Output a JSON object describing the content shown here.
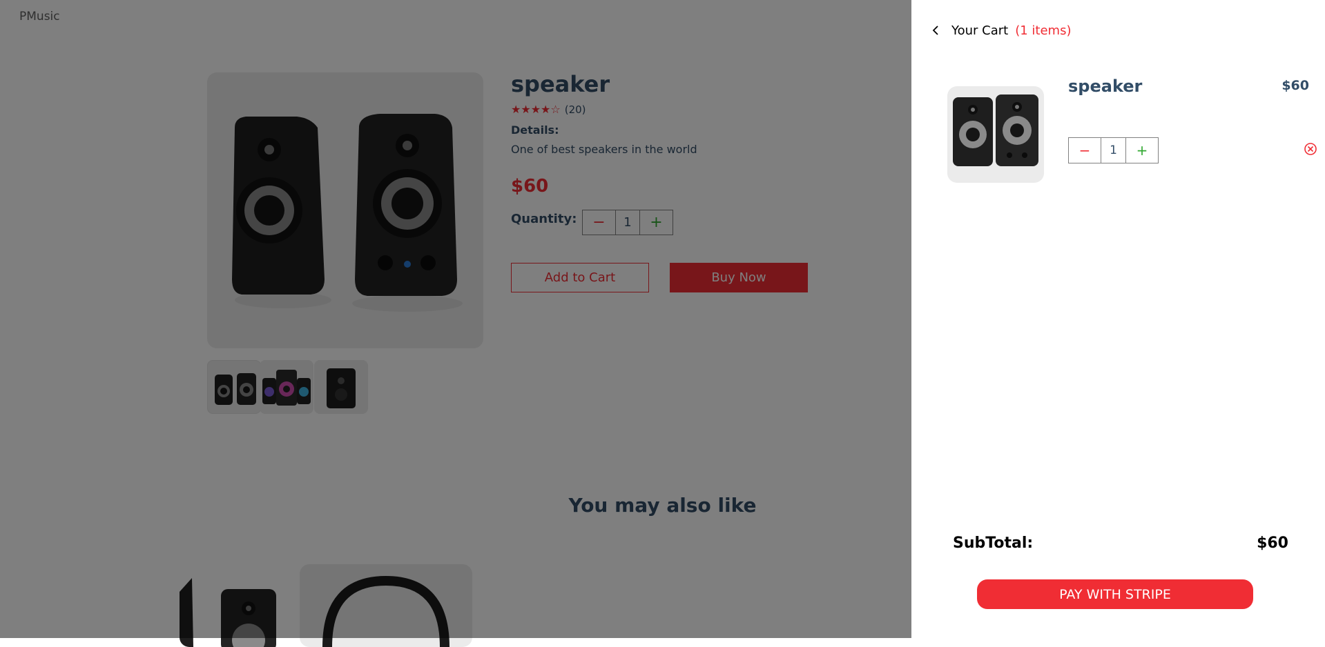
{
  "app": {
    "logo": "PMusic"
  },
  "product": {
    "title": "speaker",
    "rating_stars": "★★★★☆",
    "review_count": "(20)",
    "details_heading": "Details:",
    "details_text": "One of best speakers in the world",
    "price": "$60",
    "quantity_label": "Quantity:",
    "quantity": "1",
    "minus_symbol": "−",
    "plus_symbol": "+",
    "add_to_cart_label": "Add to Cart",
    "buy_now_label": "Buy Now"
  },
  "recommendations": {
    "heading": "You may also like"
  },
  "cart": {
    "title": "Your Cart",
    "count_label": "(1 items)",
    "items": [
      {
        "name": "speaker",
        "price": "$60",
        "quantity": "1"
      }
    ],
    "subtotal_label": "SubTotal:",
    "subtotal_value": "$60",
    "pay_button_label": "PAY WITH STRIPE"
  },
  "icons": {
    "back": "chevron-left-icon",
    "remove": "close-circle-icon"
  },
  "colors": {
    "accent": "#f02d34",
    "text": "#324d67",
    "plus": "#31a831",
    "overlay": "rgba(0,0,0,0.5)"
  }
}
